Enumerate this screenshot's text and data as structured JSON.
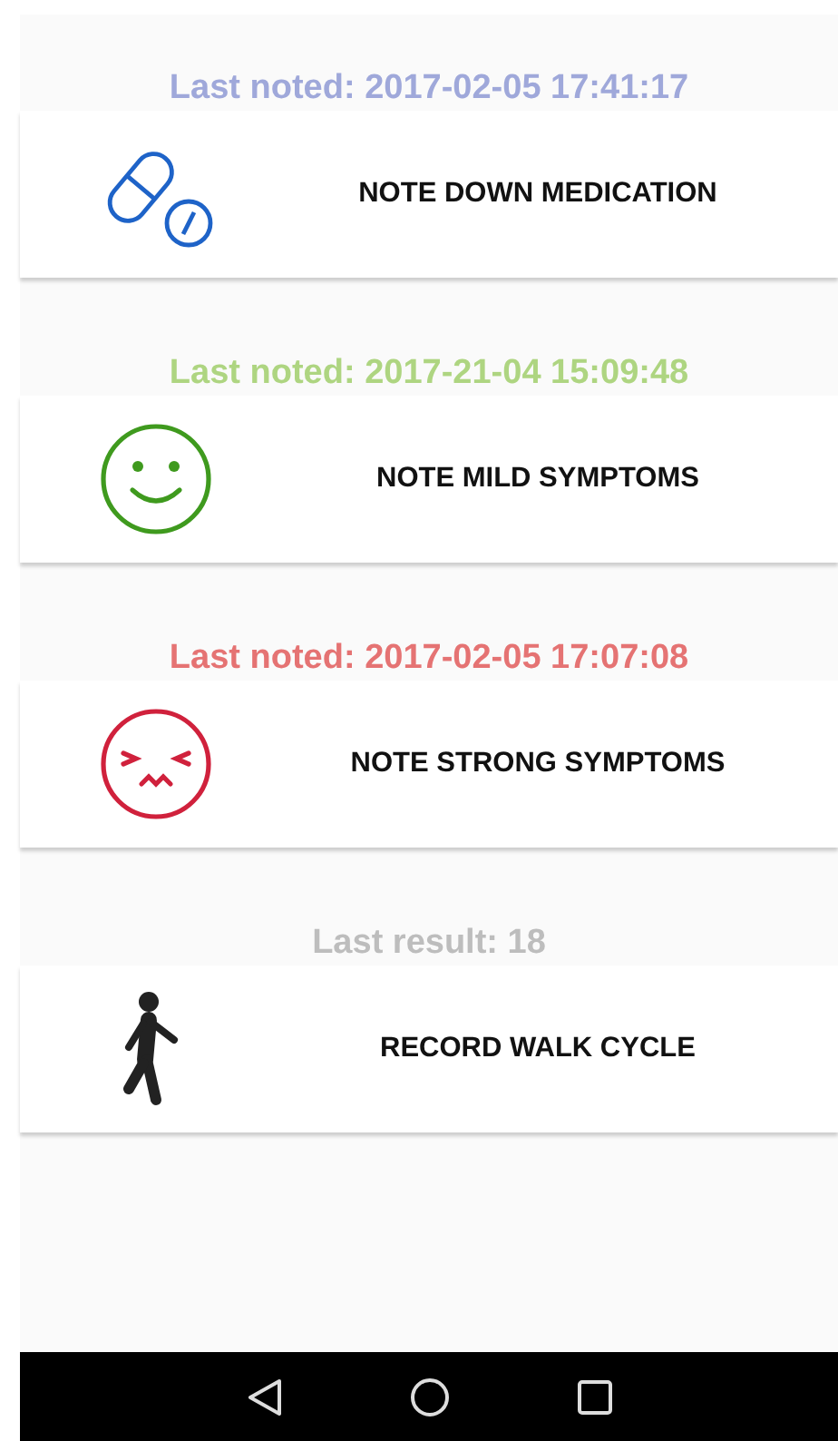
{
  "actions": [
    {
      "kind": "medication",
      "caption": "Last noted: 2017-02-05 17:41:17",
      "color": "#9fa8da",
      "label": "NOTE DOWN MEDICATION"
    },
    {
      "kind": "mild",
      "caption": "Last noted: 2017-21-04 15:09:48",
      "color": "#aed581",
      "label": "NOTE MILD SYMPTOMS"
    },
    {
      "kind": "strong",
      "caption": "Last noted: 2017-02-05 17:07:08",
      "color": "#e57373",
      "label": "NOTE STRONG SYMPTOMS"
    },
    {
      "kind": "walk",
      "caption": "Last result: 18",
      "color": "#bdbdbd",
      "label": "RECORD WALK CYCLE"
    }
  ]
}
